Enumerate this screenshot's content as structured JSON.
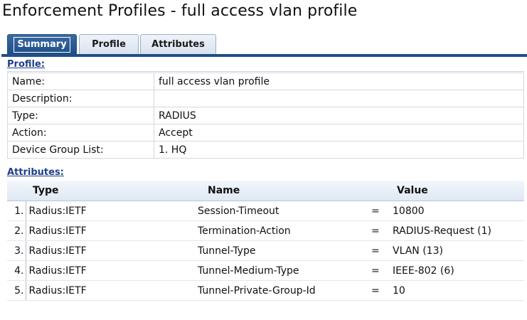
{
  "title": "Enforcement Profiles - full access vlan profile",
  "tabs": [
    {
      "label": "Summary",
      "active": true
    },
    {
      "label": "Profile",
      "active": false
    },
    {
      "label": "Attributes",
      "active": false
    }
  ],
  "profile": {
    "section_label": "Profile:",
    "rows": [
      {
        "key": "Name:",
        "value": "full access vlan profile"
      },
      {
        "key": "Description:",
        "value": ""
      },
      {
        "key": "Type:",
        "value": "RADIUS"
      },
      {
        "key": "Action:",
        "value": "Accept"
      },
      {
        "key": "Device Group List:",
        "value": "1. HQ"
      }
    ]
  },
  "attributes": {
    "section_label": "Attributes:",
    "headers": {
      "type": "Type",
      "name": "Name",
      "value": "Value"
    },
    "rows": [
      {
        "num": "1.",
        "type": "Radius:IETF",
        "name": "Session-Timeout",
        "op": "=",
        "value": "10800"
      },
      {
        "num": "2.",
        "type": "Radius:IETF",
        "name": "Termination-Action",
        "op": "=",
        "value": "RADIUS-Request (1)"
      },
      {
        "num": "3.",
        "type": "Radius:IETF",
        "name": "Tunnel-Type",
        "op": "=",
        "value": "VLAN (13)"
      },
      {
        "num": "4.",
        "type": "Radius:IETF",
        "name": "Tunnel-Medium-Type",
        "op": "=",
        "value": "IEEE-802 (6)"
      },
      {
        "num": "5.",
        "type": "Radius:IETF",
        "name": "Tunnel-Private-Group-Id",
        "op": "=",
        "value": "10"
      }
    ]
  },
  "colors": {
    "tab_active": "#1f4f86",
    "section_title": "#1f3f8a"
  }
}
